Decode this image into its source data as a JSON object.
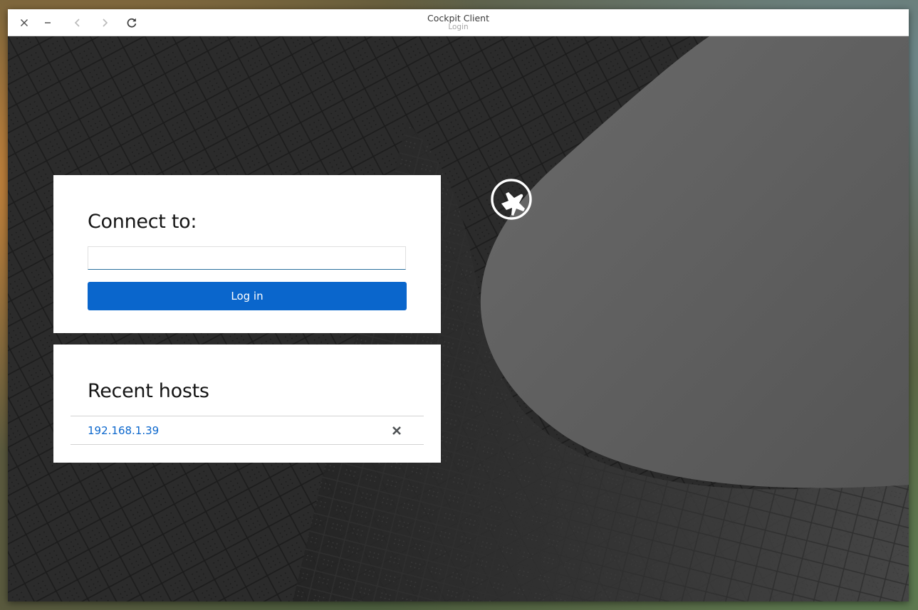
{
  "window": {
    "title": "Cockpit Client",
    "subtitle": "Login"
  },
  "titlebar": {
    "icons": [
      "close-icon",
      "minimize-icon",
      "back-icon",
      "forward-icon",
      "reload-icon"
    ]
  },
  "login": {
    "heading": "Connect to:",
    "input_value": "",
    "button_label": "Log in"
  },
  "recent": {
    "heading": "Recent hosts",
    "hosts": [
      {
        "address": "192.168.1.39"
      }
    ]
  },
  "colors": {
    "accent": "#0a66cc",
    "link": "#0a66cc",
    "card_bg": "#ffffff",
    "page_bg": "#2a2a2a"
  }
}
